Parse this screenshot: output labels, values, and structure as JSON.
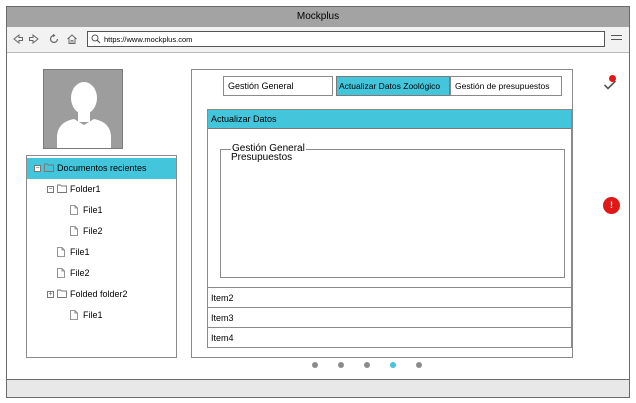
{
  "window": {
    "title": "Mockplus"
  },
  "toolbar": {
    "url": "https://www.mockplus.com",
    "icons": [
      "back-arrow-icon",
      "forward-arrow-icon",
      "refresh-icon",
      "home-icon",
      "search-icon",
      "menu-icon"
    ]
  },
  "sidebar": {
    "tree": [
      {
        "label": "Documentos recientes",
        "type": "folder",
        "expander": "−",
        "selected": true
      },
      {
        "label": "Folder1",
        "type": "folder",
        "expander": "−"
      },
      {
        "label": "File1",
        "type": "file"
      },
      {
        "label": "File2",
        "type": "file"
      },
      {
        "label": "File1",
        "type": "file"
      },
      {
        "label": "File2",
        "type": "file"
      },
      {
        "label": "Folded folder2",
        "type": "folder",
        "expander": "+"
      },
      {
        "label": "File1",
        "type": "file"
      }
    ]
  },
  "tabs": [
    {
      "label": "Gestión General",
      "active": false
    },
    {
      "label": "Actualizar Datos Zoológico",
      "active": true
    },
    {
      "label": "Gestión de presupuestos",
      "active": false
    }
  ],
  "panel": {
    "header": "Actualizar Datos",
    "fieldset_legend": "Gestión General",
    "fieldset_text": "Presupuestos",
    "items": [
      "Item2",
      "Item3",
      "Item4"
    ]
  },
  "pagination": {
    "count": 5,
    "active_index": 3
  },
  "notifications": {
    "check_icon": "check-icon",
    "alert_label": "!"
  },
  "colors": {
    "accent": "#43c6dc",
    "titlebar": "#a3a3a3",
    "alert": "#e01818",
    "avatar_bg": "#9d9d9d"
  }
}
